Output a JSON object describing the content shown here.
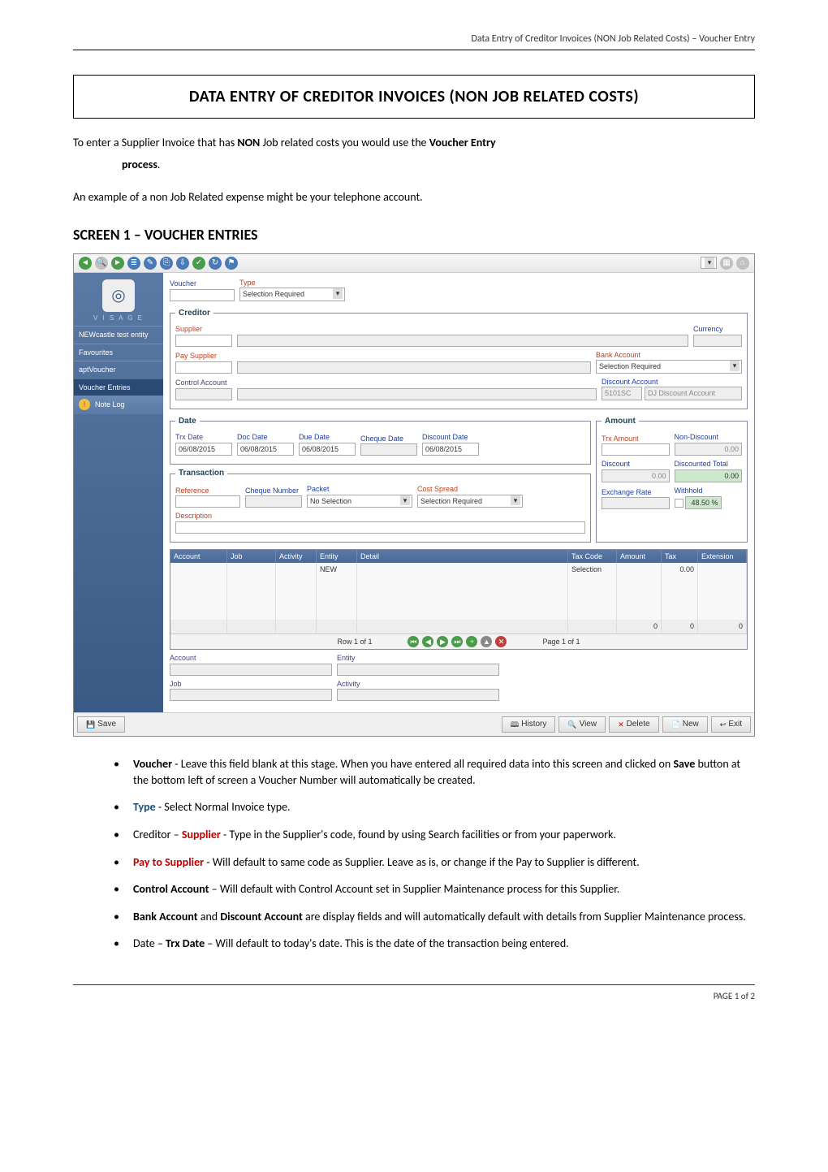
{
  "doc_header": "Data Entry of Creditor Invoices (NON Job Related Costs) – Voucher Entry",
  "title": "DATA ENTRY OF CREDITOR INVOICES (NON JOB RELATED COSTS)",
  "intro": {
    "line1_a": "To enter a Supplier Invoice that has ",
    "line1_b": "NON",
    "line1_c": " Job related costs you would use the ",
    "line1_d": "Voucher Entry",
    "line1_indent": "process",
    "line1_e": ".",
    "line2": "An example of a non Job Related expense might be your telephone account."
  },
  "section_heading": "SCREEN 1 – VOUCHER ENTRIES",
  "screenshot": {
    "sidebar": {
      "brand": "V I S A G E",
      "entity": "NEWcastle test entity",
      "items": [
        "Favourites",
        "aptVoucher"
      ],
      "sub_heading": "Voucher Entries",
      "subitem": "Note Log"
    },
    "header": {
      "voucher_label": "Voucher",
      "type_label": "Type",
      "type_value": "Selection Required"
    },
    "creditor": {
      "legend": "Creditor",
      "supplier_label": "Supplier",
      "pay_supplier_label": "Pay Supplier",
      "control_account_label": "Control Account",
      "currency_label": "Currency",
      "bank_account_label": "Bank Account",
      "bank_account_value": "Selection Required",
      "discount_account_label": "Discount Account",
      "discount_account_value": "5101SC",
      "discount_account_desc": "DJ Discount Account"
    },
    "date": {
      "legend": "Date",
      "trx_date_label": "Trx Date",
      "trx_date_value": "06/08/2015",
      "doc_date_label": "Doc Date",
      "doc_date_value": "06/08/2015",
      "due_date_label": "Due Date",
      "due_date_value": "06/08/2015",
      "cheque_date_label": "Cheque Date",
      "discount_date_label": "Discount Date",
      "discount_date_value": "06/08/2015"
    },
    "transaction": {
      "legend": "Transaction",
      "reference_label": "Reference",
      "cheque_number_label": "Cheque Number",
      "packet_label": "Packet",
      "packet_value": "No Selection",
      "description_label": "Description",
      "cost_spread_label": "Cost Spread",
      "cost_spread_value": "Selection Required"
    },
    "amount": {
      "legend": "Amount",
      "trx_amount_label": "Trx Amount",
      "non_discount_label": "Non-Discount",
      "non_discount_value": "0.00",
      "discount_label": "Discount",
      "discount_value": "0.00",
      "discounted_total_label": "Discounted Total",
      "discounted_total_value": "0.00",
      "exchange_rate_label": "Exchange Rate",
      "withhold_label": "Withhold",
      "withhold_value": "48.50 %"
    },
    "grid": {
      "headers": [
        "Account",
        "Job",
        "Activity",
        "Entity",
        "Detail",
        "Tax Code",
        "Amount",
        "Tax",
        "Extension"
      ],
      "entity_value": "NEW",
      "tax_code_value": "Selection",
      "tax_value": "0.00",
      "foot_amount": "0",
      "foot_tax": "0",
      "foot_ext": "0",
      "row_info": "Row 1 of 1",
      "page_info": "Page 1 of 1"
    },
    "below": {
      "account_label": "Account",
      "entity_label": "Entity",
      "job_label": "Job",
      "activity_label": "Activity"
    },
    "buttons": {
      "save": "Save",
      "history": "History",
      "view": "View",
      "delete": "Delete",
      "new": "New",
      "exit": "Exit"
    }
  },
  "bullets": [
    {
      "parts": [
        {
          "text": " ",
          "cls": ""
        },
        {
          "text": "Voucher",
          "cls": "bold"
        },
        {
          "text": " - Leave this field blank at this stage.  When you have entered all required data into this screen and clicked on ",
          "cls": ""
        },
        {
          "text": "Save",
          "cls": "bold"
        },
        {
          "text": " button at the bottom left of screen a Voucher Number will automatically be created.",
          "cls": ""
        }
      ]
    },
    {
      "parts": [
        {
          "text": " ",
          "cls": ""
        },
        {
          "text": "Type",
          "cls": "bold blue-text"
        },
        {
          "text": " - Select Normal Invoice type.",
          "cls": ""
        }
      ]
    },
    {
      "parts": [
        {
          "text": "Creditor – ",
          "cls": ""
        },
        {
          "text": "Supplier",
          "cls": "bold red"
        },
        {
          "text": " - Type in the Supplier's code, found by using Search facilities or from your paperwork.",
          "cls": ""
        }
      ]
    },
    {
      "parts": [
        {
          "text": "Pay to Supplier",
          "cls": "bold red"
        },
        {
          "text": " - Will default to same code as Supplier.  Leave as is, or change if the Pay to Supplier is different.",
          "cls": ""
        }
      ]
    },
    {
      "parts": [
        {
          "text": "Control Account",
          "cls": "bold"
        },
        {
          "text": " – Will default with Control Account set in Supplier Maintenance process for this Supplier.",
          "cls": ""
        }
      ]
    },
    {
      "parts": [
        {
          "text": "Bank Account",
          "cls": "bold"
        },
        {
          "text": " and ",
          "cls": ""
        },
        {
          "text": "Discount Account",
          "cls": "bold"
        },
        {
          "text": " are display fields and will automatically default with details from Supplier Maintenance process.",
          "cls": ""
        }
      ]
    },
    {
      "parts": [
        {
          "text": "Date – ",
          "cls": ""
        },
        {
          "text": "Trx Date",
          "cls": "bold"
        },
        {
          "text": " – Will default to today's date.  This is the date of the transaction being entered.",
          "cls": ""
        }
      ]
    }
  ],
  "footer": {
    "page_label": "PAGE 1 of 2"
  }
}
